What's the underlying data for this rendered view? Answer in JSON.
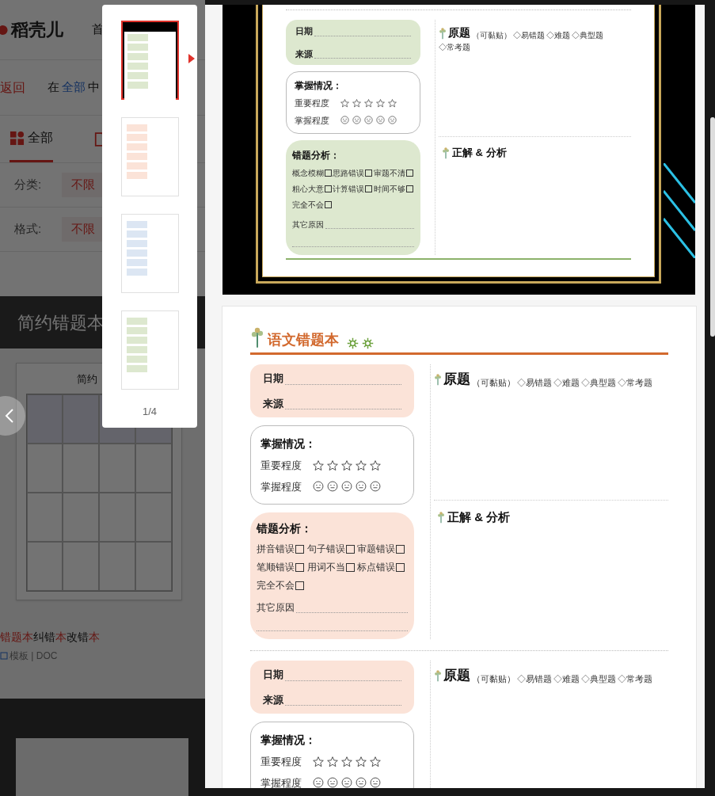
{
  "site": {
    "logo": "稻壳儿",
    "nav": [
      "首"
    ],
    "back": "返回",
    "scope": [
      {
        "text": "在",
        "kind": "plain"
      },
      {
        "text": "全部",
        "kind": "link"
      },
      {
        "text": "中",
        "kind": "plain"
      }
    ],
    "tabs": [
      {
        "label": "全部",
        "selected": true
      }
    ],
    "filters": [
      {
        "label": "分类:",
        "value": "不限"
      },
      {
        "label": "格式:",
        "value": "不限"
      }
    ],
    "banner": "简约错题本",
    "result": {
      "preview_title": "简约",
      "title": [
        {
          "text": "错题本",
          "highlight": true
        },
        {
          "text": "纠错",
          "highlight": false
        },
        {
          "text": "本",
          "highlight": true
        },
        {
          "text": "改错",
          "highlight": false
        },
        {
          "text": "本",
          "highlight": true
        }
      ],
      "meta": "模板 | DOC"
    }
  },
  "thumbnails": {
    "pages": [
      {
        "selected": true,
        "kind": "dark",
        "color": "#dde8cf"
      },
      {
        "selected": false,
        "kind": "light",
        "color": "#fbe3d8"
      },
      {
        "selected": false,
        "kind": "light",
        "color": "#dce6f3"
      },
      {
        "selected": false,
        "kind": "light",
        "color": "#dde8cf"
      }
    ],
    "counter": "1/4"
  },
  "pages": [
    {
      "kind": "framed",
      "entries": [
        {
          "color": "#dde8cf",
          "info": [
            "日期",
            "来源"
          ],
          "mastery": {
            "title": "掌握情况：",
            "rows": [
              {
                "kind": "stars",
                "label": "重要程度",
                "stars": 0
              },
              {
                "kind": "faces",
                "label": "掌握程度"
              }
            ]
          },
          "analysis": {
            "title": "错题分析：",
            "options": [
              {
                "label": "概念模糊",
                "checked": false
              },
              {
                "label": "思路错误",
                "checked": false
              },
              {
                "label": "审题不清",
                "checked": false
              },
              {
                "label": "粗心大意",
                "checked": false
              },
              {
                "label": "计算错误",
                "checked": false
              },
              {
                "label": "时间不够",
                "checked": false
              },
              {
                "label": "完全不会",
                "checked": false
              }
            ],
            "other": "其它原因"
          },
          "question": {
            "title": "原题",
            "note": "（可黏贴）",
            "types": [
              "◇易错题",
              "◇难题",
              "◇典型题",
              "◇常考题"
            ]
          },
          "answer": "正解 & 分析"
        }
      ]
    },
    {
      "kind": "plain",
      "title": "语文错题本",
      "entries": [
        {
          "color": "#fbe3d8",
          "info": [
            "日期",
            "来源"
          ],
          "mastery": {
            "title": "掌握情况：",
            "rows": [
              {
                "kind": "stars",
                "label": "重要程度",
                "stars": 0
              },
              {
                "kind": "faces",
                "label": "掌握程度"
              }
            ]
          },
          "analysis": {
            "title": "错题分析：",
            "options": [
              {
                "label": "拼音错误",
                "checked": false
              },
              {
                "label": "句子错误",
                "checked": false
              },
              {
                "label": "审题错误",
                "checked": false
              },
              {
                "label": "笔顺错误",
                "checked": false
              },
              {
                "label": "用词不当",
                "checked": false
              },
              {
                "label": "标点错误",
                "checked": false
              },
              {
                "label": "完全不会",
                "checked": false
              }
            ],
            "other": "其它原因"
          },
          "question": {
            "title": "原题",
            "note": "（可黏贴）",
            "types": [
              "◇易错题",
              "◇难题",
              "◇典型题",
              "◇常考题"
            ]
          },
          "answer": "正解 & 分析"
        },
        {
          "color": "#fbe3d8",
          "info": [
            "日期",
            "来源"
          ],
          "mastery": {
            "title": "掌握情况：",
            "rows": [
              {
                "kind": "stars",
                "label": "重要程度",
                "stars": 0
              },
              {
                "kind": "faces",
                "label": "掌握程度"
              }
            ]
          },
          "question": {
            "title": "原题",
            "note": "（可黏贴）",
            "types": [
              "◇易错题",
              "◇难题",
              "◇典型题",
              "◇常考题"
            ]
          }
        }
      ]
    }
  ]
}
